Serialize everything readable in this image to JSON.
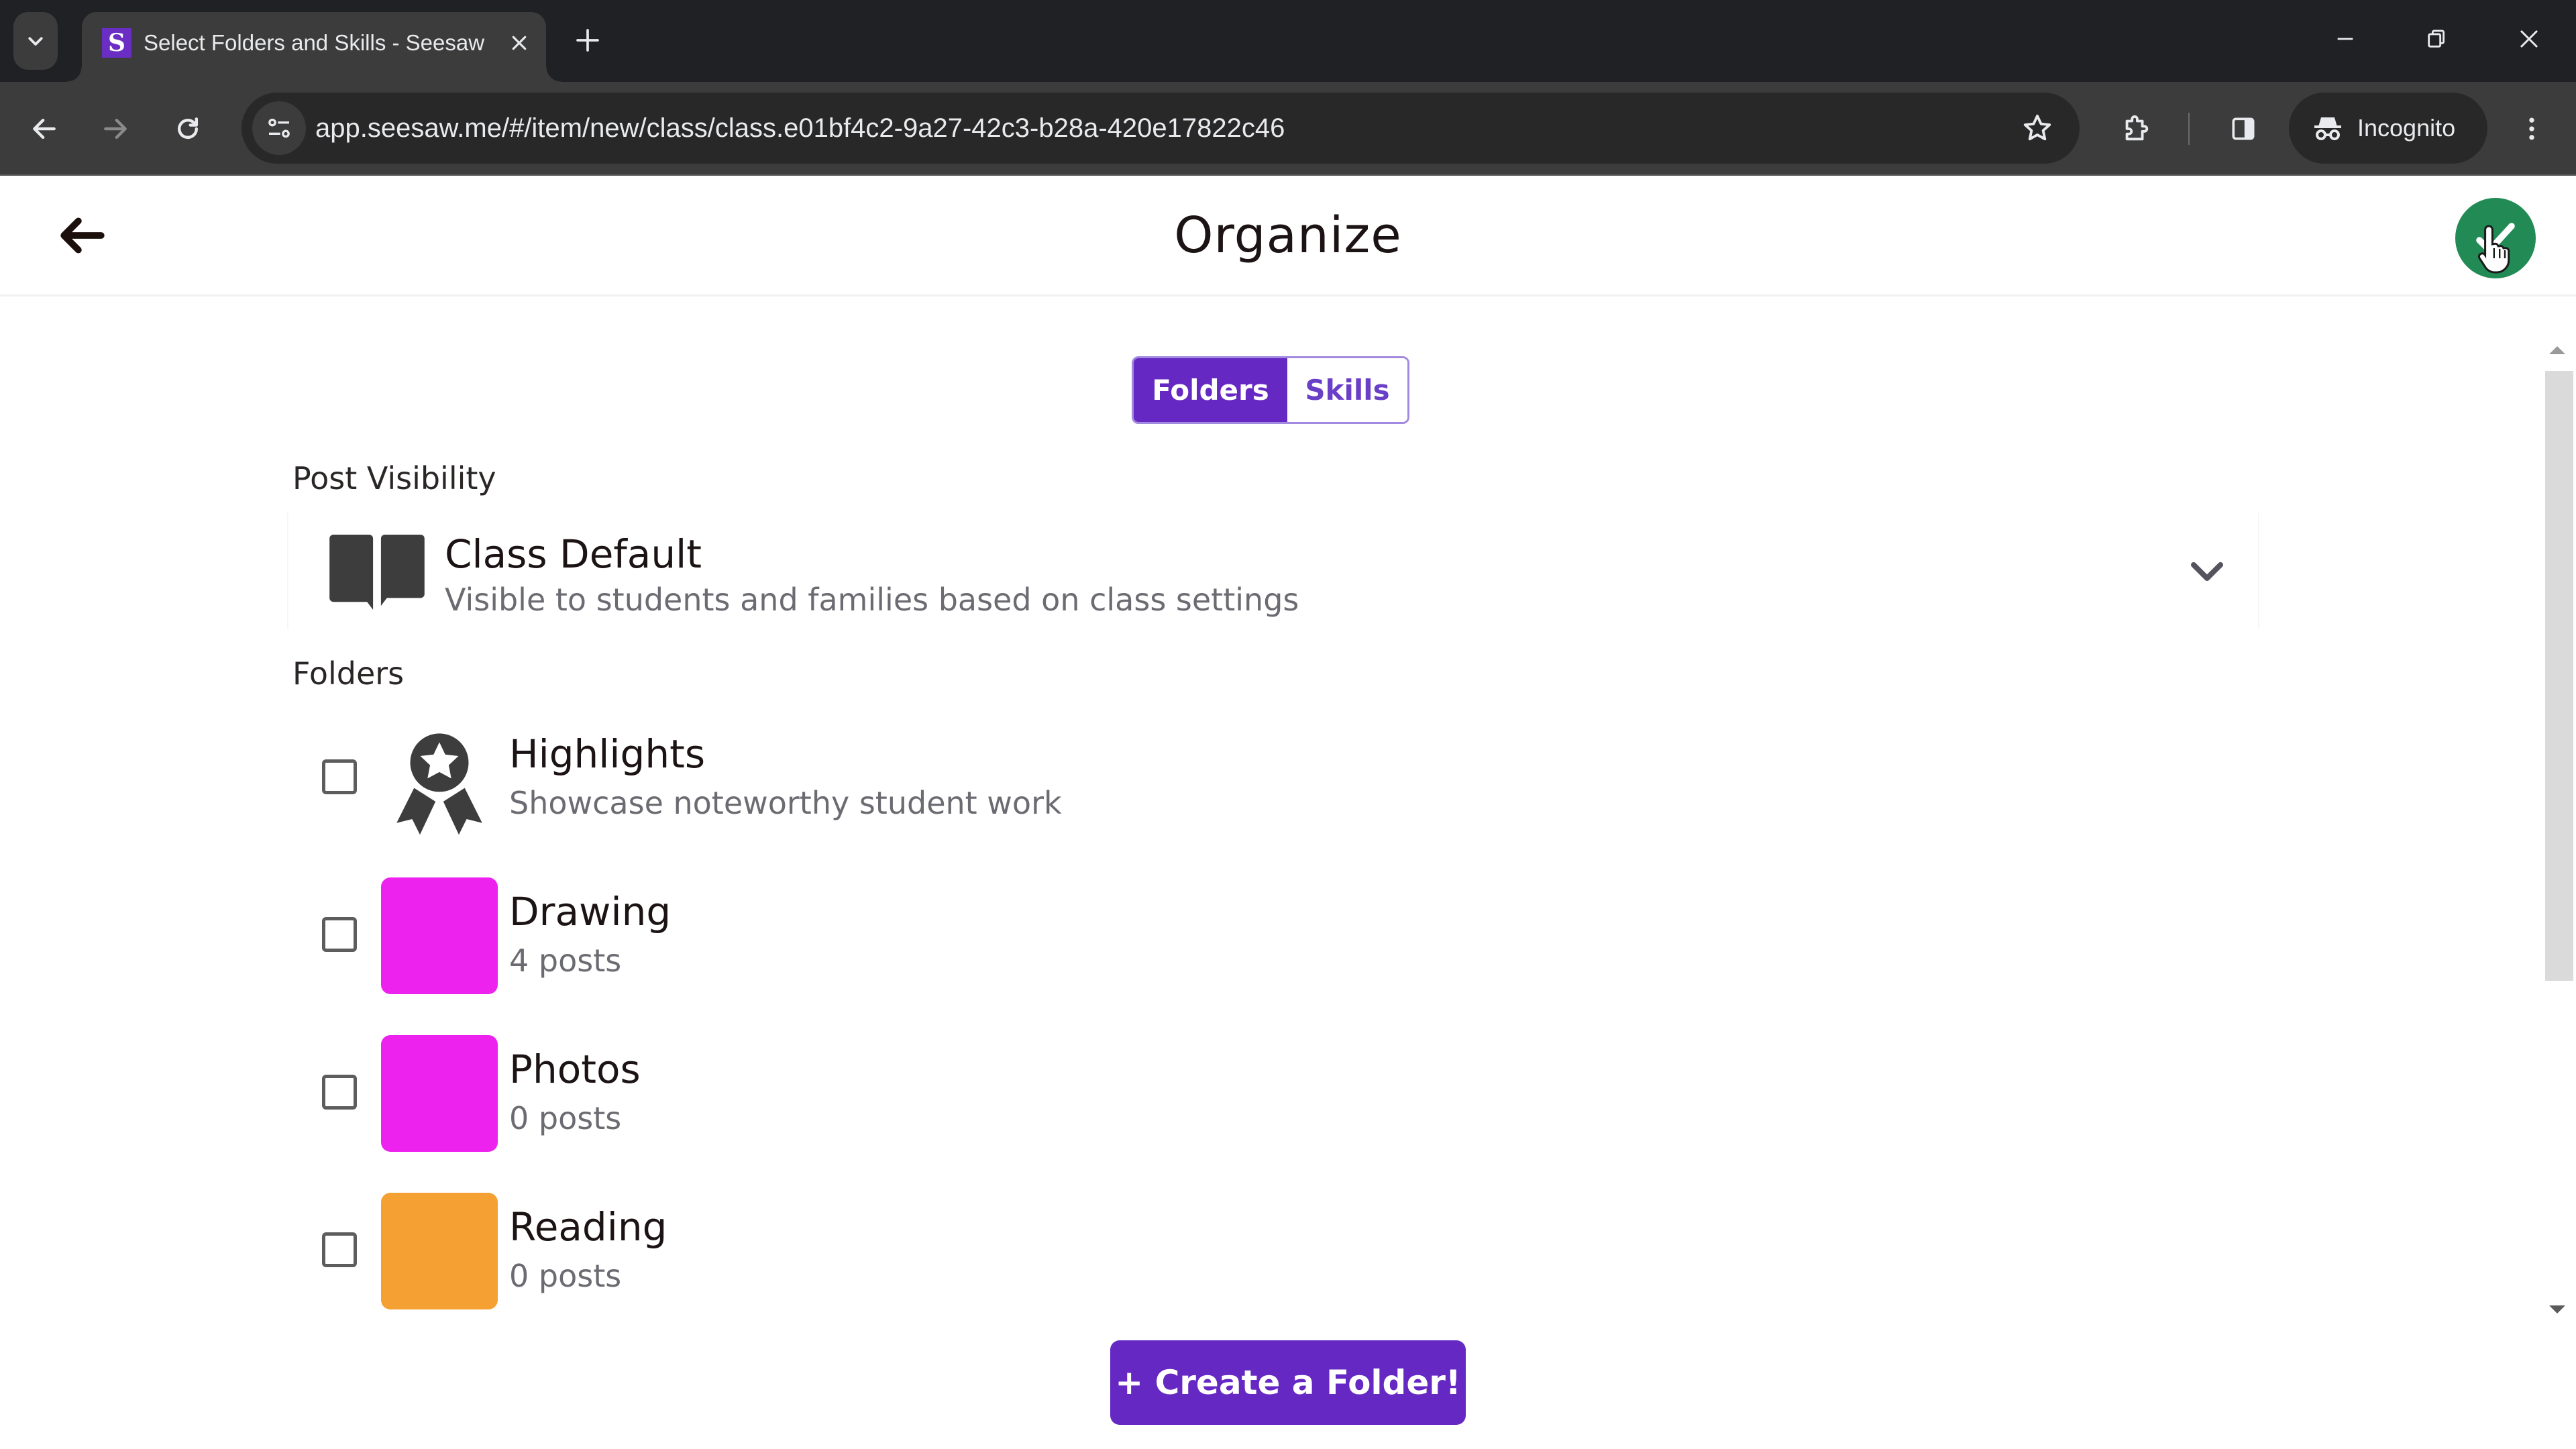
{
  "browser": {
    "tab": {
      "title": "Select Folders and Skills - Seesaw",
      "favicon": "seesaw-logo-icon",
      "favicon_color": "#6a2ec5"
    },
    "address_bar": {
      "url": "app.seesaw.me/#/item/new/class/class.e01bf4c2-9a27-42c3-b28a-420e17822c46"
    },
    "profile": {
      "label": "Incognito"
    }
  },
  "header": {
    "title": "Organize",
    "back_icon": "arrow-left-icon",
    "done_icon": "checkmark-icon",
    "done_color": "#218a55"
  },
  "segmented_control": {
    "tabs": [
      {
        "label": "Folders",
        "active": true
      },
      {
        "label": "Skills",
        "active": false
      }
    ],
    "accent_color": "#6528c2"
  },
  "post_visibility": {
    "label": "Post Visibility",
    "selected": {
      "title": "Class Default",
      "description": "Visible to students and families based on class settings",
      "icon": "open-book-icon"
    }
  },
  "folders": {
    "label": "Folders",
    "items": [
      {
        "name": "Highlights",
        "subtitle": "Showcase noteworthy student work",
        "icon": "award-ribbon-icon",
        "checked": false
      },
      {
        "name": "Drawing",
        "subtitle": "4 posts",
        "color": "#ee22ee",
        "checked": false
      },
      {
        "name": "Photos",
        "subtitle": "0 posts",
        "color": "#ee22ee",
        "checked": false
      },
      {
        "name": "Reading",
        "subtitle": "0 posts",
        "color": "#f4a032",
        "checked": false
      }
    ]
  },
  "create_button": {
    "label": "+ Create a Folder!"
  }
}
